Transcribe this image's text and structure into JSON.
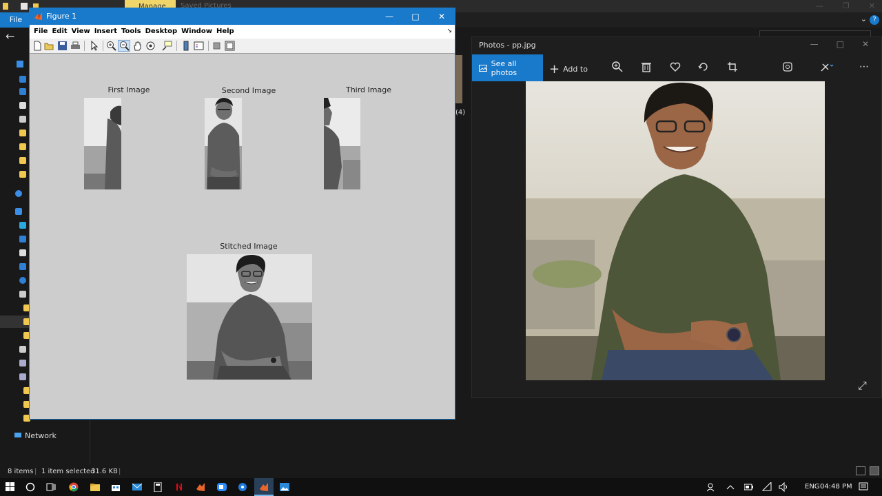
{
  "explorer": {
    "ribbon_tabs": {
      "manage": "Manage",
      "saved": "Saved Pictures"
    },
    "file_label": "File",
    "help_label": "?",
    "nav_network_label": "Network",
    "thumb_label": "(4)",
    "status": {
      "items": "8 items",
      "selected": "1 item selected",
      "size": "31.6 KB"
    }
  },
  "figure": {
    "title": "Figure 1",
    "menus": [
      "File",
      "Edit",
      "View",
      "Insert",
      "Tools",
      "Desktop",
      "Window",
      "Help"
    ],
    "axes": {
      "first_title": "First Image",
      "second_title": "Second Image",
      "third_title": "Third Image",
      "stitched_title": "Stitched Image"
    }
  },
  "photos": {
    "title": "Photos - pp.jpg",
    "see_all_label": "See all photos",
    "add_to_label": "Add to"
  },
  "taskbar": {
    "lang": "ENG",
    "time": "04:48 PM"
  },
  "colors": {
    "accent": "#1979ca",
    "figure_bg": "#cdcdcd",
    "dark_bg": "#191919"
  }
}
